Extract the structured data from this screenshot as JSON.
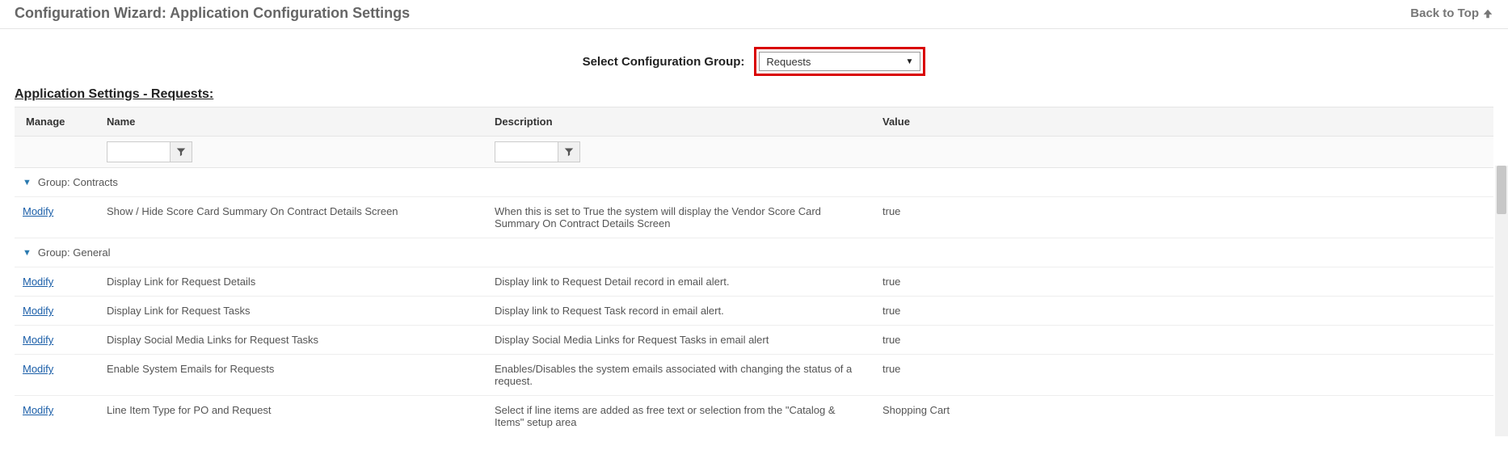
{
  "header": {
    "title": "Configuration Wizard: Application Configuration Settings",
    "backToTop": "Back to Top"
  },
  "selector": {
    "label": "Select Configuration Group:",
    "value": "Requests"
  },
  "sectionTitle": "Application Settings - Requests:",
  "columns": {
    "manage": "Manage",
    "name": "Name",
    "description": "Description",
    "value": "Value"
  },
  "modifyLabel": "Modify",
  "groups": [
    {
      "label": "Group: Contracts",
      "rows": [
        {
          "name": "Show / Hide Score Card Summary On Contract Details Screen",
          "description": "When this is set to True the system will display the Vendor Score Card Summary On Contract Details Screen",
          "value": "true"
        }
      ]
    },
    {
      "label": "Group: General",
      "rows": [
        {
          "name": "Display Link for Request Details",
          "description": "Display link to Request Detail record in email alert.",
          "value": "true"
        },
        {
          "name": "Display Link for Request Tasks",
          "description": "Display link to Request Task record in email alert.",
          "value": "true"
        },
        {
          "name": "Display Social Media Links for Request Tasks",
          "description": "Display Social Media Links for Request Tasks in email alert",
          "value": "true"
        },
        {
          "name": "Enable System Emails for Requests",
          "description": "Enables/Disables the system emails associated with changing the status of a request.",
          "value": "true"
        },
        {
          "name": "Line Item Type for PO and Request",
          "description": "Select if line items are added as free text or selection from the \"Catalog & Items\" setup area",
          "value": "Shopping Cart"
        }
      ]
    }
  ]
}
